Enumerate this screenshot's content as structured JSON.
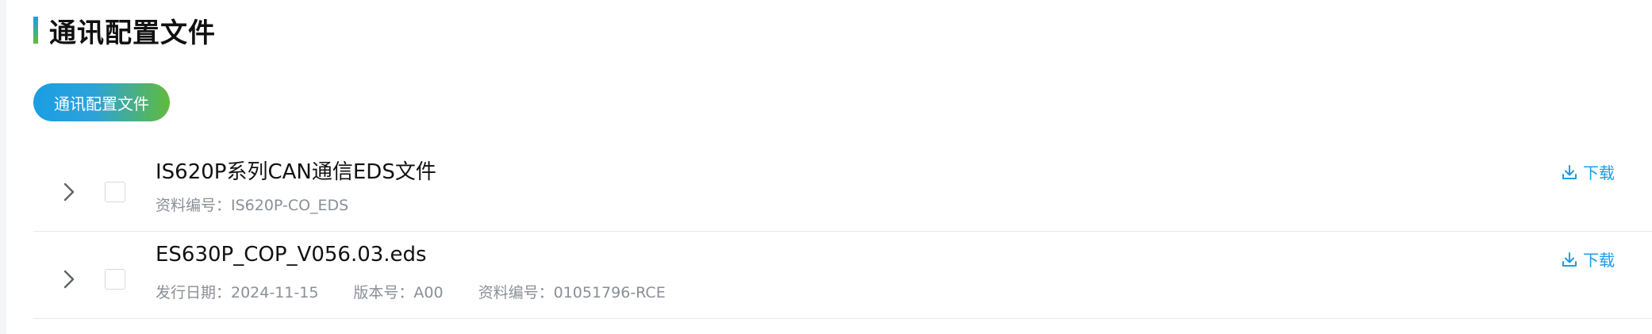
{
  "page": {
    "section_title": "通讯配置文件",
    "accent_gradient": [
      "#14a0e6",
      "#62bd3a"
    ]
  },
  "tabs": [
    {
      "label": "通讯配置文件",
      "active": true
    }
  ],
  "files": [
    {
      "title": "IS620P系列CAN通信EDS文件",
      "meta": {
        "doc_no": "资料编号：IS620P-CO_EDS"
      },
      "download_label": "下载"
    },
    {
      "title": "ES630P_COP_V056.03.eds",
      "meta": {
        "release_date": "发行日期：2024-11-15",
        "version": "版本号：A00",
        "doc_no": "资料编号：01051796-RCE"
      },
      "download_label": "下载"
    }
  ],
  "icons": {
    "expand": "chevron-right-icon",
    "download": "download-icon"
  },
  "colors": {
    "link": "#1a9ee4",
    "meta_text": "#8a8f96",
    "divider": "#e6e8eb"
  }
}
